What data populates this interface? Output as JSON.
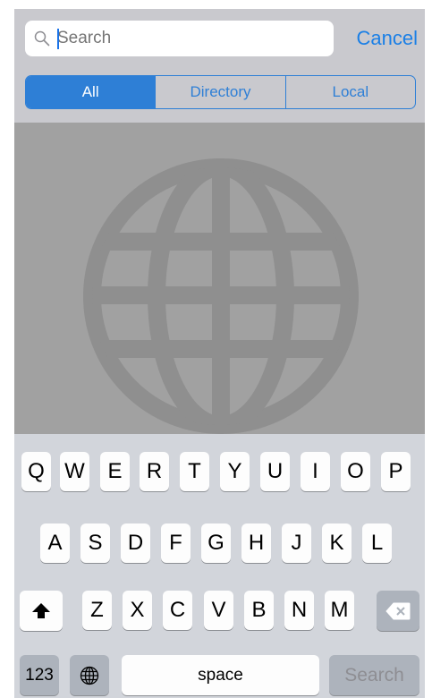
{
  "search": {
    "placeholder": "Search",
    "value": "",
    "cancel_label": "Cancel"
  },
  "segments": [
    {
      "label": "All",
      "selected": true
    },
    {
      "label": "Directory",
      "selected": false
    },
    {
      "label": "Local",
      "selected": false
    }
  ],
  "icons": {
    "search": "magnifier-icon",
    "globe": "globe-icon",
    "shift": "shift-icon",
    "delete": "delete-icon"
  },
  "colors": {
    "accent": "#2e7fd6",
    "bar_background": "#c9c9ce",
    "globe_background": "#a1a1a1",
    "keyboard_background": "#d2d5db"
  },
  "keyboard": {
    "row1": [
      "Q",
      "W",
      "E",
      "R",
      "T",
      "Y",
      "U",
      "I",
      "O",
      "P"
    ],
    "row2": [
      "A",
      "S",
      "D",
      "F",
      "G",
      "H",
      "J",
      "K",
      "L"
    ],
    "row3": [
      "Z",
      "X",
      "C",
      "V",
      "B",
      "N",
      "M"
    ],
    "numbers_label": "123",
    "space_label": "space",
    "search_label": "Search"
  }
}
